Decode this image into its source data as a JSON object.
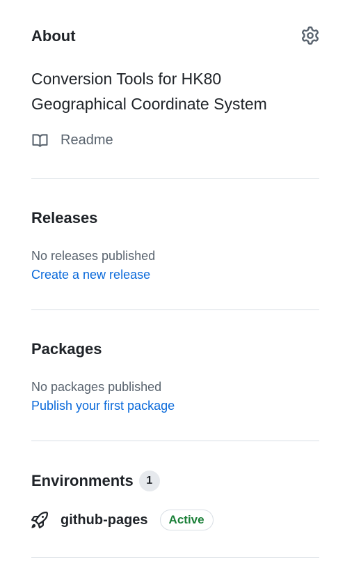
{
  "about": {
    "heading": "About",
    "description": "Conversion Tools for HK80 Geographical Coordinate System",
    "readme_label": "Readme",
    "settings_icon": "gear-icon"
  },
  "releases": {
    "heading": "Releases",
    "empty_text": "No releases published",
    "create_link": "Create a new release"
  },
  "packages": {
    "heading": "Packages",
    "empty_text": "No packages published",
    "publish_link": "Publish your first package"
  },
  "environments": {
    "heading": "Environments",
    "count": "1",
    "items": [
      {
        "name": "github-pages",
        "status": "Active",
        "icon": "rocket-icon"
      }
    ]
  },
  "colors": {
    "link": "#0969da",
    "muted": "#59636e",
    "active": "#1a7f37",
    "border": "#d8dee4"
  }
}
